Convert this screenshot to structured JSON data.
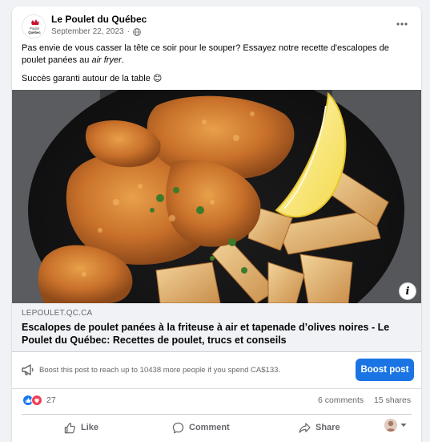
{
  "post": {
    "page_name": "Le Poulet du Québec",
    "logo_text": "Poulet Québec",
    "date": "September 22, 2023",
    "date_separator": "·",
    "text_line1_part1": "Pas envie de vous casser la tête ce soir pour le souper? Essayez notre recette d'escalopes de poulet panées au ",
    "text_line1_italic": "air fryer",
    "text_line1_end": ".",
    "text_line2": "Succès garanti autour de la table 😊",
    "image_alt": "Escalopes de poulet panées avec frites et quartier de citron",
    "info_icon": "i"
  },
  "link": {
    "domain": "LEPOULET.QC.CA",
    "title": "Escalopes de poulet panées à la friteuse à air et tapenade d’olives noires - Le Poulet du Québec: Recettes de poulet, trucs et conseils"
  },
  "boost": {
    "text": "Boost this post to reach up to 10438 more people if you spend CA$133.",
    "button_label": "Boost post"
  },
  "stats": {
    "reaction_count": "27",
    "comments": "6 comments",
    "shares": "15 shares"
  },
  "actions": {
    "like": "Like",
    "comment": "Comment",
    "share": "Share"
  },
  "colors": {
    "accent": "#1b74e4",
    "like_blue": "#1877f2",
    "love_red": "#f33e58",
    "secondary_text": "#65676b"
  }
}
